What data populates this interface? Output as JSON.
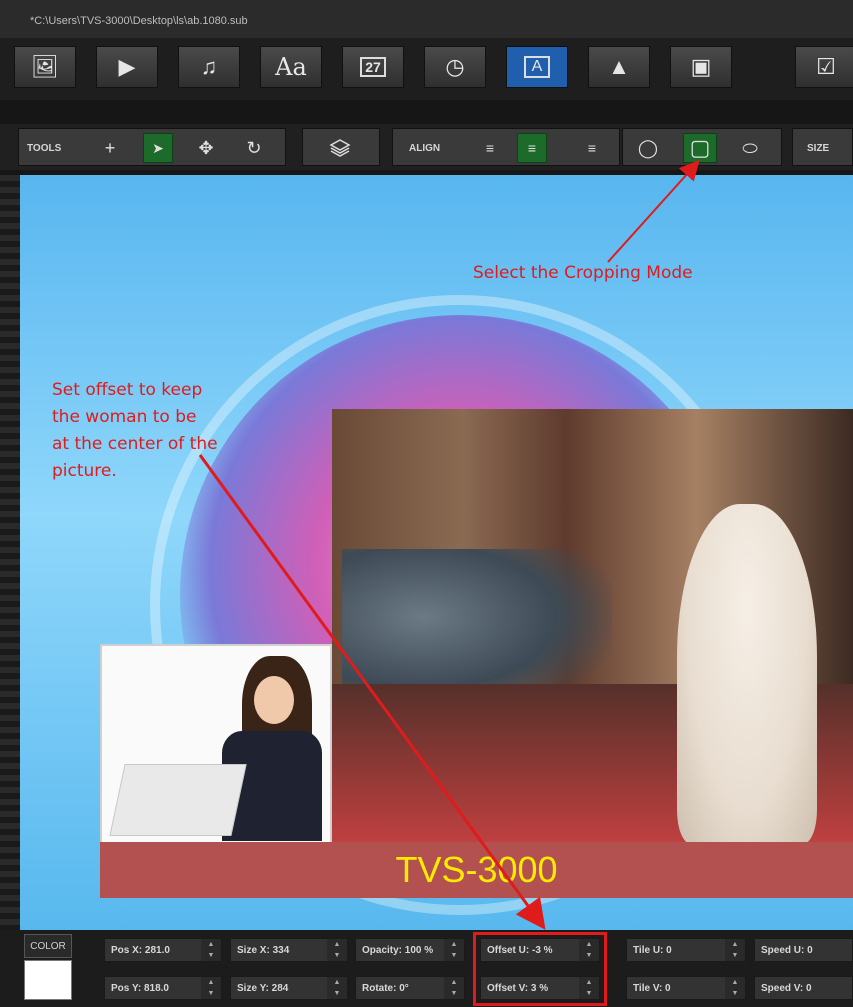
{
  "window": {
    "title": "*C:\\Users\\TVS-3000\\Desktop\\ls\\ab.1080.sub"
  },
  "icon_bar": {
    "items": [
      {
        "icon": "image-icon",
        "glyph": "🖼"
      },
      {
        "icon": "video-play-icon",
        "glyph": "▶"
      },
      {
        "icon": "music-note-icon",
        "glyph": "♫"
      },
      {
        "icon": "text-font-icon",
        "glyph": "Aa"
      },
      {
        "icon": "calendar-icon",
        "glyph": "27"
      },
      {
        "icon": "clock-icon",
        "glyph": "◷"
      },
      {
        "icon": "text-box-icon",
        "glyph": "A",
        "active": true
      },
      {
        "icon": "shapes-icon",
        "glyph": "▲"
      },
      {
        "icon": "media-slide-icon",
        "glyph": "▣"
      },
      {
        "icon": "checkbox-icon",
        "glyph": "☑"
      }
    ]
  },
  "toolbar": {
    "tools_label": "TOOLS",
    "tools": [
      {
        "icon": "plus-icon",
        "glyph": "+"
      },
      {
        "icon": "select-arrow-icon",
        "glyph": "➤",
        "selected": true
      },
      {
        "icon": "move-icon",
        "glyph": "✥"
      },
      {
        "icon": "rotate-icon",
        "glyph": "↻"
      }
    ],
    "layers_icon": "layers-icon",
    "align_label": "ALIGN",
    "align": [
      {
        "icon": "align-left-icon",
        "glyph": "≡"
      },
      {
        "icon": "align-center-icon",
        "glyph": "≡",
        "selected": true
      },
      {
        "icon": "align-right-icon",
        "glyph": "≡"
      }
    ],
    "crop_modes": [
      {
        "icon": "crop-circle-icon",
        "glyph": "◯"
      },
      {
        "icon": "crop-rounded-rect-icon",
        "glyph": "▢",
        "selected": true
      },
      {
        "icon": "crop-ellipse-icon",
        "glyph": "⬭"
      }
    ],
    "size_label": "SIZE"
  },
  "canvas": {
    "banner_text": "TVS-3000",
    "annotation_crop": "Select the Cropping Mode",
    "annotation_offset": [
      "Set offset to keep",
      "the woman to be",
      "at the center of the",
      "picture."
    ]
  },
  "properties": {
    "color_label": "COLOR",
    "color_value": "#ffffff",
    "fields": [
      {
        "label": "Pos X: 281.0"
      },
      {
        "label": "Pos Y: 818.0"
      },
      {
        "label": "Size X: 334"
      },
      {
        "label": "Size Y: 284"
      },
      {
        "label": "Opacity: 100 %"
      },
      {
        "label": "Rotate: 0°"
      },
      {
        "label": "Offset U: -3 %"
      },
      {
        "label": "Offset V: 3 %"
      },
      {
        "label": "Tile U: 0"
      },
      {
        "label": "Tile V: 0"
      },
      {
        "label": "Speed U: 0"
      },
      {
        "label": "Speed V: 0"
      }
    ]
  },
  "colors": {
    "accent": "#1f5fae",
    "selected": "#1c6b2a",
    "annotation": "#e01b1b",
    "banner": "#b25150",
    "banner_text": "#ffea00"
  }
}
